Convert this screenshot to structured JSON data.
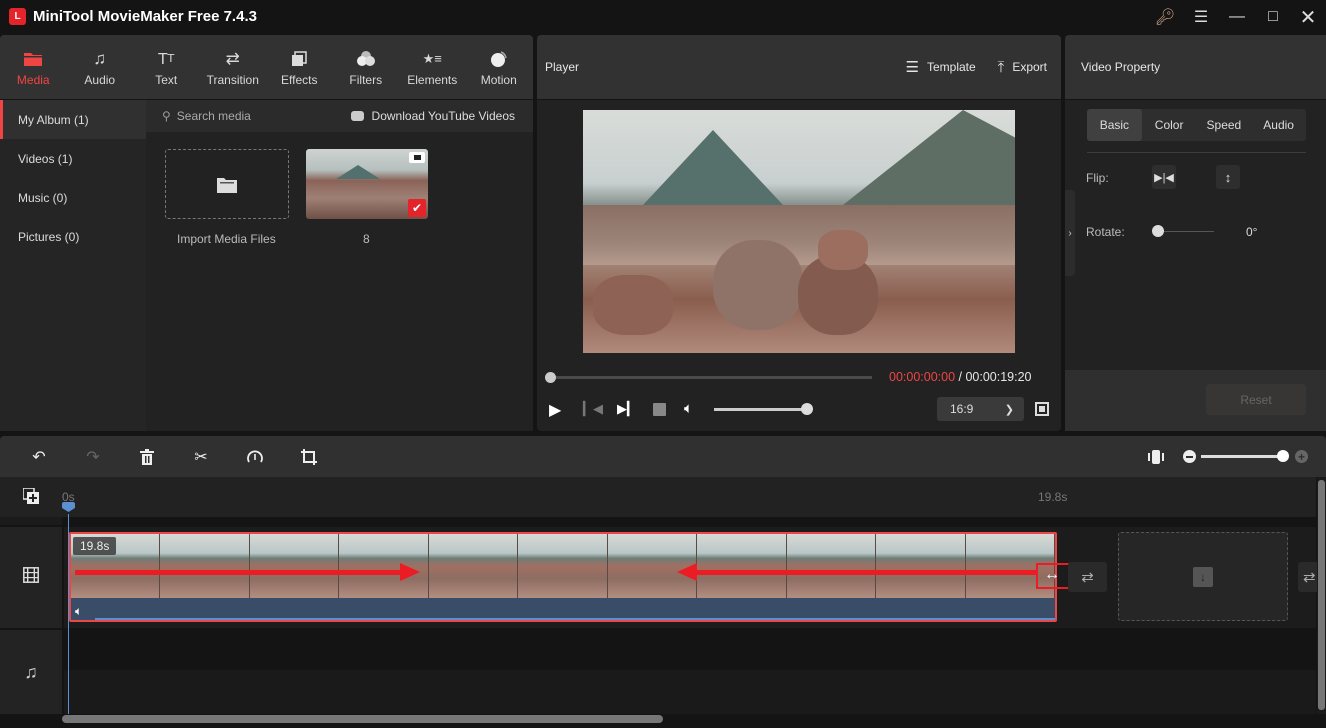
{
  "app": {
    "title": "MiniTool MovieMaker Free 7.4.3",
    "logo": "L"
  },
  "window_controls": {
    "key": "key-icon",
    "menu": "menu-icon",
    "minimize": "minimize-icon",
    "maximize": "maximize-icon",
    "close": "close-icon"
  },
  "accent_color": "#f04545",
  "toolbar": {
    "tabs": [
      {
        "label": "Media",
        "icon": "folder-icon",
        "active": true
      },
      {
        "label": "Audio",
        "icon": "music-icon"
      },
      {
        "label": "Text",
        "icon": "text-icon"
      },
      {
        "label": "Transition",
        "icon": "transition-icon"
      },
      {
        "label": "Effects",
        "icon": "effects-icon"
      },
      {
        "label": "Filters",
        "icon": "filters-icon"
      },
      {
        "label": "Elements",
        "icon": "elements-icon"
      },
      {
        "label": "Motion",
        "icon": "motion-icon"
      }
    ]
  },
  "media": {
    "sidebar": [
      {
        "label": "My Album (1)",
        "active": true
      },
      {
        "label": "Videos (1)"
      },
      {
        "label": "Music (0)"
      },
      {
        "label": "Pictures (0)"
      }
    ],
    "search_placeholder": "Search media",
    "download_label": "Download YouTube Videos",
    "import_label": "Import Media Files",
    "item_name": "8"
  },
  "player": {
    "title": "Player",
    "template_label": "Template",
    "export_label": "Export",
    "current_time": "00:00:00:00",
    "separator": " / ",
    "total_time": "00:00:19:20",
    "progress": 0,
    "volume": 1.0,
    "aspect_ratio": "16:9"
  },
  "property": {
    "title": "Video Property",
    "tabs": [
      {
        "label": "Basic",
        "active": true
      },
      {
        "label": "Color"
      },
      {
        "label": "Speed"
      },
      {
        "label": "Audio"
      }
    ],
    "flip_label": "Flip:",
    "rotate_label": "Rotate:",
    "rotate_value": "0°",
    "reset_label": "Reset"
  },
  "timeline": {
    "ruler_start": "0s",
    "ruler_end": "19.8s",
    "clip_duration": "19.8s",
    "zoom_level": 1.0
  }
}
